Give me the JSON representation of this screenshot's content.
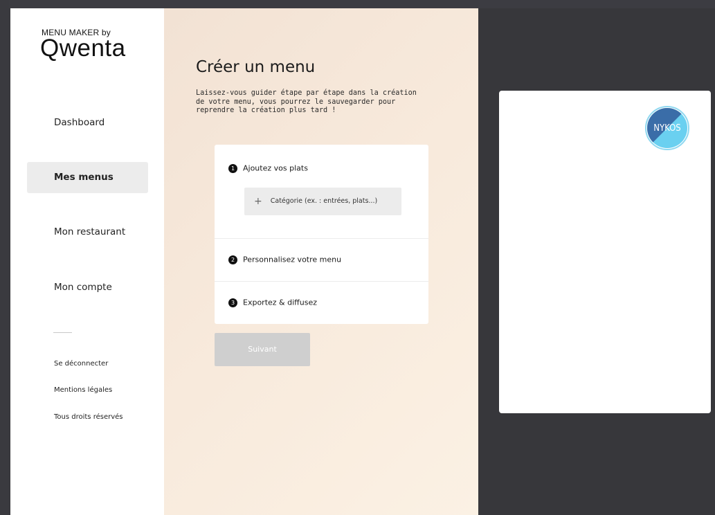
{
  "brand": {
    "tagline": "MENU MAKER by",
    "name": "Qwenta"
  },
  "sidebar": {
    "items": [
      {
        "label": "Dashboard",
        "active": false
      },
      {
        "label": "Mes menus",
        "active": true
      },
      {
        "label": "Mon restaurant",
        "active": false
      },
      {
        "label": "Mon compte",
        "active": false
      }
    ],
    "footer_links": [
      "Se déconnecter",
      "Mentions légales",
      "Tous droits réservés"
    ]
  },
  "main": {
    "title": "Créer un menu",
    "intro": "Laissez-vous guider étape par étape dans la création de votre menu, vous pourrez le sauvegarder pour reprendre la création plus tard !",
    "steps": [
      {
        "number": "1",
        "label": "Ajoutez vos plats"
      },
      {
        "number": "2",
        "label": "Personnalisez votre menu"
      },
      {
        "number": "3",
        "label": "Exportez & diffusez"
      }
    ],
    "category_button": {
      "icon": "plus-icon",
      "label": "Catégorie (ex. : entrées, plats...)"
    },
    "next_button": "Suivant"
  },
  "preview": {
    "logo_text": "NYKOS"
  },
  "colors": {
    "active_nav_bg": "#ececec",
    "main_bg": "#f6e8da",
    "disabled_button": "#cfcfcf",
    "logo_blue_dark": "#3a6da8",
    "logo_blue_light": "#6ad0f0"
  }
}
